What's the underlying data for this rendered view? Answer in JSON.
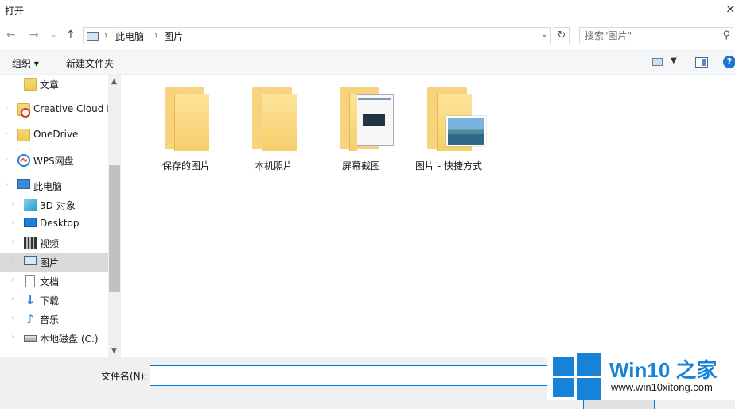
{
  "window": {
    "title": "打开",
    "close_glyph": "×"
  },
  "address": {
    "crumbs": [
      "此电脑",
      "图片"
    ],
    "separator": "›",
    "search_placeholder": "搜索\"图片\""
  },
  "toolbar": {
    "organize_label": "组织 ▾",
    "new_folder_label": "新建文件夹",
    "help_glyph": "?"
  },
  "sidebar": {
    "items": [
      {
        "label": "文章",
        "icon": "folder-icon"
      },
      {
        "label": "Creative Cloud F",
        "icon": "creative-cloud-icon"
      },
      {
        "label": "OneDrive",
        "icon": "folder-icon"
      },
      {
        "label": "WPS网盘",
        "icon": "wps-cloud-icon"
      },
      {
        "label": "此电脑",
        "icon": "computer-icon"
      },
      {
        "label": "3D 对象",
        "icon": "cube-icon"
      },
      {
        "label": "Desktop",
        "icon": "desktop-icon"
      },
      {
        "label": "视频",
        "icon": "film-icon"
      },
      {
        "label": "图片",
        "icon": "picture-icon",
        "selected": true
      },
      {
        "label": "文档",
        "icon": "document-icon"
      },
      {
        "label": "下载",
        "icon": "download-arrow-icon"
      },
      {
        "label": "音乐",
        "icon": "music-note-icon"
      },
      {
        "label": "本地磁盘 (C:)",
        "icon": "disk-drive-icon"
      }
    ]
  },
  "files": [
    {
      "label": "保存的图片",
      "icon": "folder-icon"
    },
    {
      "label": "本机照片",
      "icon": "folder-icon"
    },
    {
      "label": "屏幕截图",
      "icon": "folder-screenshot-icon"
    },
    {
      "label": "图片 - 快捷方式",
      "icon": "folder-shortcut-landscape-icon"
    }
  ],
  "filename": {
    "label": "文件名(N):",
    "value": ""
  },
  "watermark": {
    "title": "Win10 之家",
    "url": "www.win10xitong.com"
  },
  "colors": {
    "accent": "#0078d7",
    "brand": "#1683d8",
    "selected_bg": "#d9d9d9",
    "folder": "#f6d37c"
  }
}
